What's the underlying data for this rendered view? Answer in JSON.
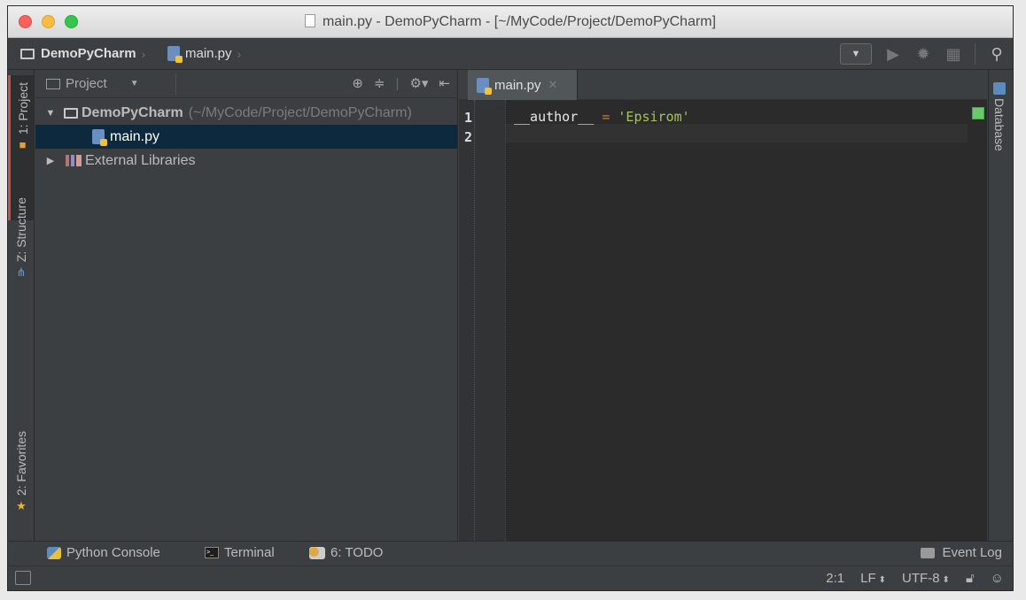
{
  "window": {
    "title": "main.py - DemoPyCharm - [~/MyCode/Project/DemoPyCharm]"
  },
  "navbar": {
    "project_crumb": "DemoPyCharm",
    "file_crumb": "main.py"
  },
  "left_stripe": {
    "project_tab": "1: Project",
    "structure_tab": "Z: Structure",
    "favorites_tab": "2: Favorites"
  },
  "right_stripe": {
    "database_tab": "Database"
  },
  "project_panel": {
    "title": "Project",
    "tree": {
      "root_name": "DemoPyCharm",
      "root_path": "(~/MyCode/Project/DemoPyCharm)",
      "file": "main.py",
      "libraries": "External Libraries"
    }
  },
  "editor": {
    "tab_label": "main.py",
    "line_numbers": [
      "1",
      "2"
    ],
    "code": {
      "ident": "__author__",
      "op": "=",
      "str": "'Epsirom'"
    }
  },
  "bottom_bar": {
    "python_console": "Python Console",
    "terminal": "Terminal",
    "todo": "6: TODO",
    "event_log": "Event Log"
  },
  "status_bar": {
    "position": "2:1",
    "line_sep": "LF",
    "encoding": "UTF-8"
  }
}
